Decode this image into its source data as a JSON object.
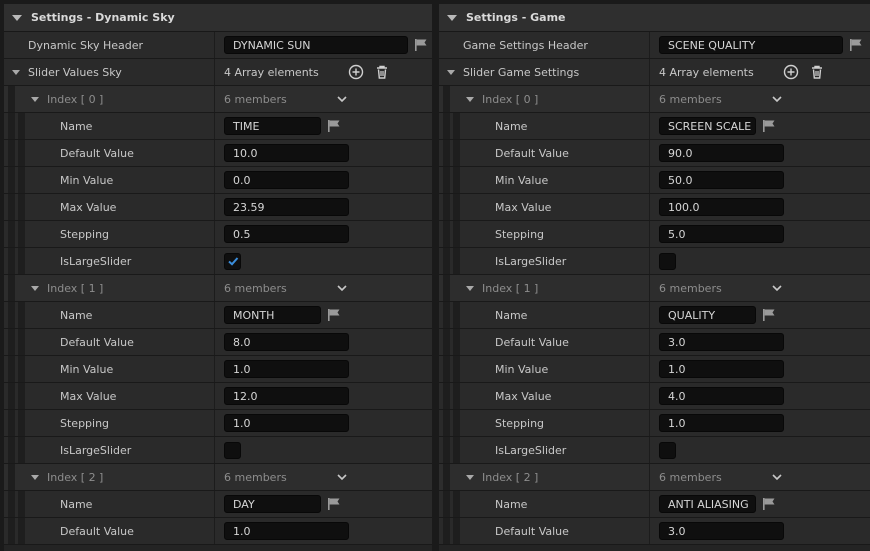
{
  "colors": {
    "checkbox_accent": "#3a8ddb",
    "background": "#1a1a1a",
    "row": "#2a2a2a"
  },
  "left": {
    "section_title": "Settings - Dynamic Sky",
    "header_label": "Dynamic Sky Header",
    "header_value": "DYNAMIC SUN",
    "array_label": "Slider Values Sky",
    "array_count": "4 Array elements",
    "indices": [
      {
        "label": "Index [ 0 ]",
        "members": "6 members",
        "name": "TIME",
        "default": "10.0",
        "min": "0.0",
        "max": "23.59",
        "stepping": "0.5",
        "is_large": true
      },
      {
        "label": "Index [ 1 ]",
        "members": "6 members",
        "name": "MONTH",
        "default": "8.0",
        "min": "1.0",
        "max": "12.0",
        "stepping": "1.0",
        "is_large": false
      },
      {
        "label": "Index [ 2 ]",
        "members": "6 members",
        "name": "DAY",
        "default": "1.0"
      }
    ]
  },
  "right": {
    "section_title": "Settings - Game",
    "header_label": "Game Settings Header",
    "header_value": "SCENE QUALITY",
    "array_label": "Slider Game Settings",
    "array_count": "4 Array elements",
    "indices": [
      {
        "label": "Index [ 0 ]",
        "members": "6 members",
        "name": "SCREEN SCALE",
        "default": "90.0",
        "min": "50.0",
        "max": "100.0",
        "stepping": "5.0",
        "is_large": false
      },
      {
        "label": "Index [ 1 ]",
        "members": "6 members",
        "name": "QUALITY",
        "default": "3.0",
        "min": "1.0",
        "max": "4.0",
        "stepping": "1.0",
        "is_large": false
      },
      {
        "label": "Index [ 2 ]",
        "members": "6 members",
        "name": "ANTI ALIASING",
        "default": "3.0"
      }
    ]
  },
  "labels": {
    "name": "Name",
    "default": "Default Value",
    "min": "Min Value",
    "max": "Max Value",
    "stepping": "Stepping",
    "is_large": "IsLargeSlider"
  }
}
